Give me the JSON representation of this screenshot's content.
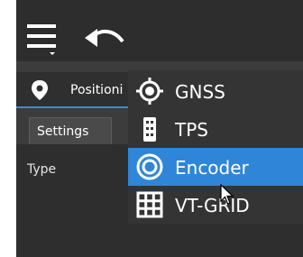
{
  "header": {
    "menu_icon": "hamburger-menu-icon",
    "undo_icon": "undo-icon"
  },
  "tabs": {
    "position_label": "Positioni",
    "position_icon": "location-pin-icon"
  },
  "panel": {
    "settings_tab": "Settings",
    "type_label": "Type"
  },
  "dropdown": {
    "items": [
      {
        "label": "GNSS",
        "icon": "gnss-crosshair-icon",
        "selected": false
      },
      {
        "label": "TPS",
        "icon": "tps-total-station-icon",
        "selected": false
      },
      {
        "label": "Encoder",
        "icon": "encoder-ring-icon",
        "selected": true
      },
      {
        "label": "VT-GRID",
        "icon": "grid-icon",
        "selected": false
      }
    ]
  },
  "colors": {
    "accent": "#2f86d8",
    "background": "#3c3c3c",
    "topbar": "#2d2d2d"
  }
}
